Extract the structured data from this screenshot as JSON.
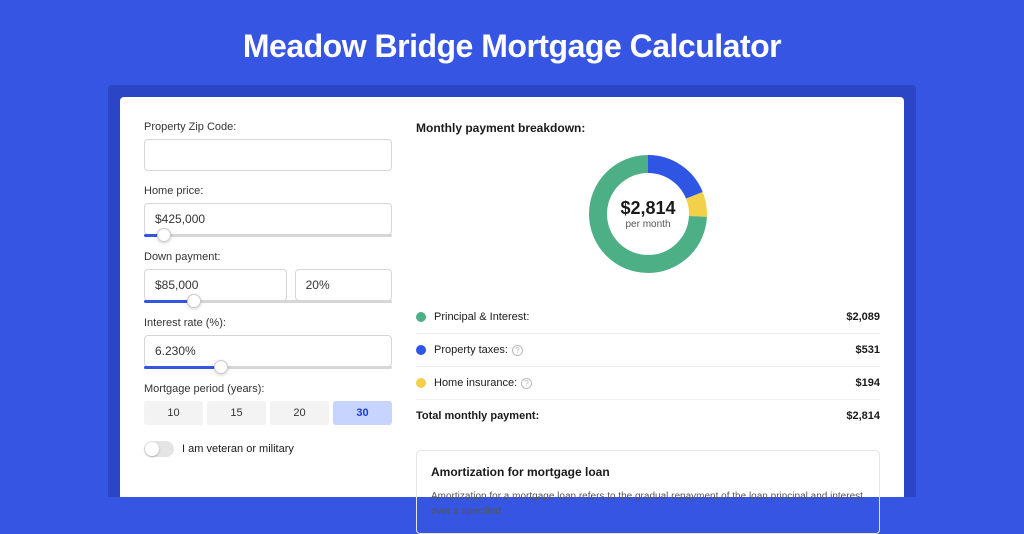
{
  "title": "Meadow Bridge Mortgage Calculator",
  "form": {
    "zip_label": "Property Zip Code:",
    "zip_value": "",
    "home_price_label": "Home price:",
    "home_price_value": "$425,000",
    "home_price_slider_pct": 8,
    "down_payment_label": "Down payment:",
    "down_payment_value": "$85,000",
    "down_payment_pct_value": "20%",
    "down_payment_slider_pct": 20,
    "interest_label": "Interest rate (%):",
    "interest_value": "6.230%",
    "interest_slider_pct": 31,
    "period_label": "Mortgage period (years):",
    "periods": [
      "10",
      "15",
      "20",
      "30"
    ],
    "period_active_index": 3,
    "veteran_label": "I am veteran or military"
  },
  "breakdown": {
    "title": "Monthly payment breakdown:",
    "donut_amount": "$2,814",
    "donut_sub": "per month",
    "rows": [
      {
        "color": "#4caf85",
        "label": "Principal & Interest:",
        "value": "$2,089",
        "info": false
      },
      {
        "color": "#2f55e5",
        "label": "Property taxes:",
        "value": "$531",
        "info": true
      },
      {
        "color": "#f2d04a",
        "label": "Home insurance:",
        "value": "$194",
        "info": true
      }
    ],
    "total_label": "Total monthly payment:",
    "total_value": "$2,814"
  },
  "amort": {
    "title": "Amortization for mortgage loan",
    "body": "Amortization for a mortgage loan refers to the gradual repayment of the loan principal and interest over a specified"
  },
  "chart_data": {
    "type": "pie",
    "title": "Monthly payment breakdown",
    "series": [
      {
        "name": "Principal & Interest",
        "value": 2089,
        "color": "#4caf85"
      },
      {
        "name": "Property taxes",
        "value": 531,
        "color": "#2f55e5"
      },
      {
        "name": "Home insurance",
        "value": 194,
        "color": "#f2d04a"
      }
    ],
    "total": 2814,
    "center_label": "$2,814 per month"
  }
}
